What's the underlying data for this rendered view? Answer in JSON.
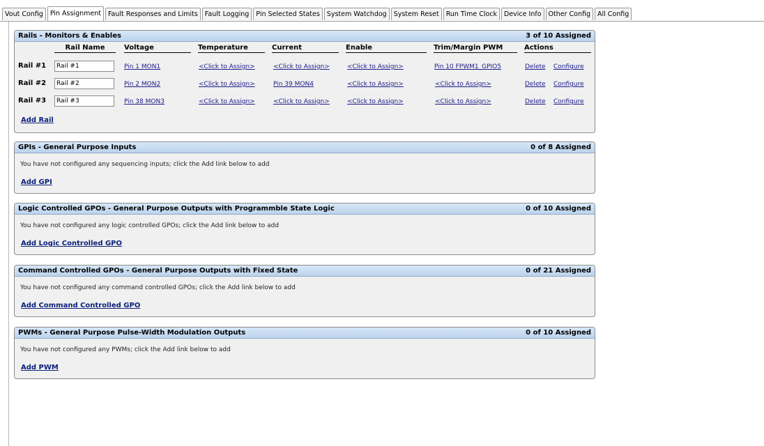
{
  "tabs": [
    "Vout Config",
    "Pin Assignment",
    "Fault Responses and Limits",
    "Fault Logging",
    "Pin Selected States",
    "System Watchdog",
    "System Reset",
    "Run Time Clock",
    "Device Info",
    "Other Config",
    "All Config"
  ],
  "active_tab": "Pin Assignment",
  "rails": {
    "title": "Rails - Monitors & Enables",
    "count": "3 of 10 Assigned",
    "columns": [
      "Rail Name",
      "Voltage",
      "Temperature",
      "Current",
      "Enable",
      "Trim/Margin PWM",
      "Actions"
    ],
    "rows": [
      {
        "label": "Rail #1",
        "name": "Rail #1",
        "voltage": "Pin 1 MON1",
        "temperature": "<Click to Assign>",
        "current": "<Click to Assign>",
        "enable": "<Click to Assign>",
        "trim": "Pin 10 FPWM1_GPIO5",
        "delete": "Delete",
        "configure": "Configure"
      },
      {
        "label": "Rail #2",
        "name": "Rail #2",
        "voltage": "Pin 2 MON2",
        "temperature": "<Click to Assign>",
        "current": "Pin 39 MON4",
        "enable": "<Click to Assign>",
        "trim": "<Click to Assign>",
        "delete": "Delete",
        "configure": "Configure"
      },
      {
        "label": "Rail #3",
        "name": "Rail #3",
        "voltage": "Pin 38 MON3",
        "temperature": "<Click to Assign>",
        "current": "<Click to Assign>",
        "enable": "<Click to Assign>",
        "trim": "<Click to Assign>",
        "delete": "Delete",
        "configure": "Configure"
      }
    ],
    "add_label": "Add Rail"
  },
  "gpis": {
    "title": "GPIs - General Purpose Inputs",
    "count": "0 of 8 Assigned",
    "message": "You have not configured any sequencing inputs; click the Add link below to add",
    "add_label": "Add GPI"
  },
  "logic_gpos": {
    "title": "Logic Controlled GPOs - General Purpose Outputs with Programmble State Logic",
    "count": "0 of 10 Assigned",
    "message": "You have not configured any logic controlled GPOs; click the Add link below to add",
    "add_label": "Add Logic Controlled GPO"
  },
  "command_gpos": {
    "title": "Command Controlled GPOs - General Purpose Outputs with Fixed State",
    "count": "0 of 21 Assigned",
    "message": "You have not configured any command controlled GPOs; click the Add link below to add",
    "add_label": "Add Command Controlled GPO"
  },
  "pwms": {
    "title": "PWMs - General Purpose Pulse-Width Modulation Outputs",
    "count": "0 of 10 Assigned",
    "message": "You have not configured any PWMs; click the Add link below to add",
    "add_label": "Add PWM"
  },
  "colors": {
    "header_gradient_top": "#d7e7f8",
    "header_gradient_bottom": "#bcd3ec",
    "panel_bg": "#f0f0f0",
    "link": "#1a1a8c"
  }
}
